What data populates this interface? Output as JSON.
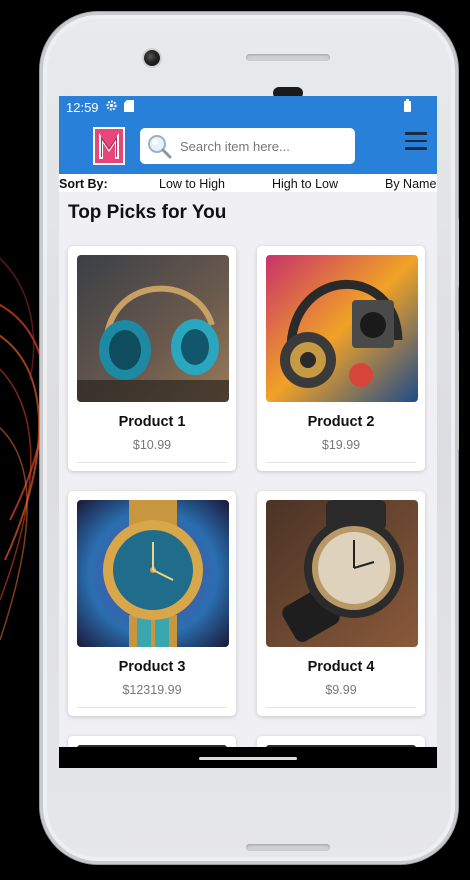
{
  "status_bar": {
    "time": "12:59"
  },
  "search": {
    "placeholder": "Search item here..."
  },
  "sort": {
    "label": "Sort By:",
    "options": [
      "Low to High",
      "High to Low",
      "By Name"
    ]
  },
  "section": {
    "title": "Top Picks for You"
  },
  "products": [
    {
      "name": "Product 1",
      "price": "$10.99",
      "image": "headphones-teal"
    },
    {
      "name": "Product 2",
      "price": "$19.99",
      "image": "headphones-retro"
    },
    {
      "name": "Product 3",
      "price": "$12319.99",
      "image": "watch-gold"
    },
    {
      "name": "Product 4",
      "price": "$9.99",
      "image": "watch-black"
    }
  ],
  "colors": {
    "app_bar": "#2980d9",
    "screen_bg": "#f0f0f4",
    "logo_pink": "#e8457a"
  }
}
